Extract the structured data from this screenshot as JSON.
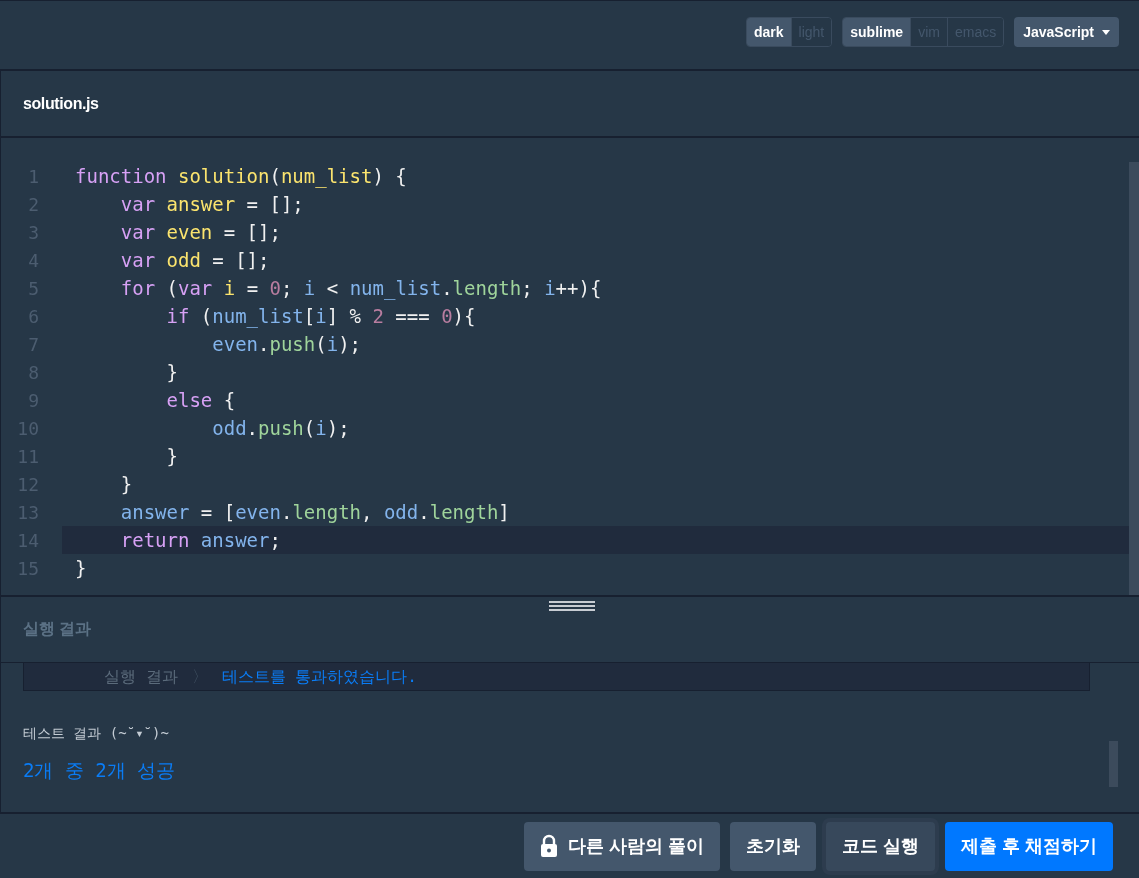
{
  "toolbar": {
    "theme_options": [
      {
        "label": "dark",
        "selected": true
      },
      {
        "label": "light",
        "selected": false
      }
    ],
    "keymap_options": [
      {
        "label": "sublime",
        "selected": true
      },
      {
        "label": "vim",
        "selected": false
      },
      {
        "label": "emacs",
        "selected": false
      }
    ],
    "language": "JavaScript"
  },
  "file_tab": {
    "title": "solution.js"
  },
  "editor": {
    "lines": [
      {
        "number": "1",
        "highlighted": false,
        "tokens": [
          {
            "t": "function ",
            "color": "#d7a1f5"
          },
          {
            "t": "solution",
            "color": "#fbe46e"
          },
          {
            "t": "("
          },
          {
            "t": "num_list",
            "color": "#fbe46e"
          },
          {
            "t": ") {"
          }
        ]
      },
      {
        "number": "2",
        "highlighted": false,
        "tokens": [
          {
            "t": "    var ",
            "color": "#d7a1f5"
          },
          {
            "t": "answer",
            "color": "#fbe46e"
          },
          {
            "t": " = [];"
          }
        ]
      },
      {
        "number": "3",
        "highlighted": false,
        "tokens": [
          {
            "t": "    var ",
            "color": "#d7a1f5"
          },
          {
            "t": "even",
            "color": "#fbe46e"
          },
          {
            "t": " = [];"
          }
        ]
      },
      {
        "number": "4",
        "highlighted": false,
        "tokens": [
          {
            "t": "    var ",
            "color": "#d7a1f5"
          },
          {
            "t": "odd",
            "color": "#fbe46e"
          },
          {
            "t": " = [];"
          }
        ]
      },
      {
        "number": "5",
        "highlighted": false,
        "tokens": [
          {
            "t": "    for",
            "color": "#d7a1f5"
          },
          {
            "t": " ("
          },
          {
            "t": "var ",
            "color": "#d7a1f5"
          },
          {
            "t": "i",
            "color": "#fbe46e"
          },
          {
            "t": " = "
          },
          {
            "t": "0",
            "color": "#b87da0"
          },
          {
            "t": "; "
          },
          {
            "t": "i",
            "color": "#83b4ec"
          },
          {
            "t": " < "
          },
          {
            "t": "num_list",
            "color": "#83b4ec"
          },
          {
            "t": "."
          },
          {
            "t": "length",
            "color": "#9fd49b"
          },
          {
            "t": "; "
          },
          {
            "t": "i",
            "color": "#83b4ec"
          },
          {
            "t": "++){"
          }
        ]
      },
      {
        "number": "6",
        "highlighted": false,
        "tokens": [
          {
            "t": "        if",
            "color": "#d7a1f5"
          },
          {
            "t": " ("
          },
          {
            "t": "num_list",
            "color": "#83b4ec"
          },
          {
            "t": "["
          },
          {
            "t": "i",
            "color": "#83b4ec"
          },
          {
            "t": "] % "
          },
          {
            "t": "2",
            "color": "#b87da0"
          },
          {
            "t": " === "
          },
          {
            "t": "0",
            "color": "#b87da0"
          },
          {
            "t": "){"
          }
        ]
      },
      {
        "number": "7",
        "highlighted": false,
        "tokens": [
          {
            "t": "            even",
            "color": "#83b4ec"
          },
          {
            "t": "."
          },
          {
            "t": "push",
            "color": "#9fd49b"
          },
          {
            "t": "("
          },
          {
            "t": "i",
            "color": "#83b4ec"
          },
          {
            "t": ");"
          }
        ]
      },
      {
        "number": "8",
        "highlighted": false,
        "tokens": [
          {
            "t": "        }"
          }
        ]
      },
      {
        "number": "9",
        "highlighted": false,
        "tokens": [
          {
            "t": "        else",
            "color": "#d7a1f5"
          },
          {
            "t": " {"
          }
        ]
      },
      {
        "number": "10",
        "highlighted": false,
        "tokens": [
          {
            "t": "            odd",
            "color": "#83b4ec"
          },
          {
            "t": "."
          },
          {
            "t": "push",
            "color": "#9fd49b"
          },
          {
            "t": "("
          },
          {
            "t": "i",
            "color": "#83b4ec"
          },
          {
            "t": ");"
          }
        ]
      },
      {
        "number": "11",
        "highlighted": false,
        "tokens": [
          {
            "t": "        }"
          }
        ]
      },
      {
        "number": "12",
        "highlighted": false,
        "tokens": [
          {
            "t": "    }"
          }
        ]
      },
      {
        "number": "13",
        "highlighted": false,
        "tokens": [
          {
            "t": "    answer",
            "color": "#83b4ec"
          },
          {
            "t": " = ["
          },
          {
            "t": "even",
            "color": "#83b4ec"
          },
          {
            "t": "."
          },
          {
            "t": "length",
            "color": "#9fd49b"
          },
          {
            "t": ", "
          },
          {
            "t": "odd",
            "color": "#83b4ec"
          },
          {
            "t": "."
          },
          {
            "t": "length",
            "color": "#9fd49b"
          },
          {
            "t": "]"
          }
        ]
      },
      {
        "number": "14",
        "highlighted": true,
        "tokens": [
          {
            "t": "    return ",
            "color": "#d7a1f5"
          },
          {
            "t": "answer",
            "color": "#83b4ec"
          },
          {
            "t": ";"
          }
        ]
      },
      {
        "number": "15",
        "highlighted": false,
        "tokens": [
          {
            "t": "}"
          }
        ]
      }
    ]
  },
  "results": {
    "title": "실행 결과",
    "output": {
      "label": "실행 결과",
      "separator": "〉",
      "message": "테스트를 통과하였습니다."
    },
    "test_heading": "테스트 결과 (~˘▾˘)~",
    "summary": "2개 중 2개 성공"
  },
  "buttons": [
    {
      "label": "다른 사람의 풀이",
      "kind": "locked"
    },
    {
      "label": "초기화",
      "kind": "secondary"
    },
    {
      "label": "코드 실행",
      "kind": "run"
    },
    {
      "label": "제출 후 채점하기",
      "kind": "primary"
    }
  ]
}
